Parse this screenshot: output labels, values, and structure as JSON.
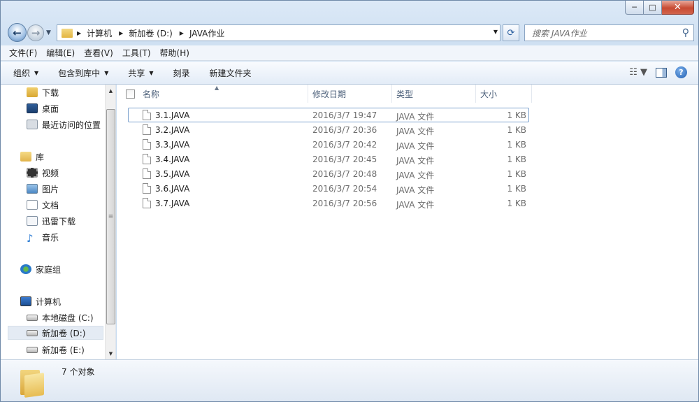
{
  "window": {
    "controls": {
      "minimize": "─",
      "maximize": "□",
      "close": "✕"
    }
  },
  "navigation": {
    "back_icon": "arrow-left",
    "forward_icon": "arrow-right",
    "breadcrumb": [
      "计算机",
      "新加卷 (D:)",
      "JAVA作业"
    ],
    "search_placeholder": "搜索 JAVA作业"
  },
  "menubar": [
    "文件(F)",
    "编辑(E)",
    "查看(V)",
    "工具(T)",
    "帮助(H)"
  ],
  "toolbar": {
    "organize": "组织",
    "include_in_library": "包含到库中",
    "share": "共享",
    "burn": "刻录",
    "new_folder": "新建文件夹"
  },
  "sidebar": {
    "favorites": [
      "下载",
      "桌面",
      "最近访问的位置"
    ],
    "libraries_header": "库",
    "libraries": [
      "视频",
      "图片",
      "文档",
      "迅雷下载",
      "音乐"
    ],
    "homegroup": "家庭组",
    "computer_header": "计算机",
    "drives": [
      "本地磁盘 (C:)",
      "新加卷 (D:)",
      "新加卷 (E:)"
    ],
    "selected": "新加卷 (D:)"
  },
  "columns": {
    "name": "名称",
    "date": "修改日期",
    "type": "类型",
    "size": "大小"
  },
  "files": [
    {
      "name": "3.1.JAVA",
      "date": "2016/3/7 19:47",
      "type": "JAVA 文件",
      "size": "1 KB"
    },
    {
      "name": "3.2.JAVA",
      "date": "2016/3/7 20:36",
      "type": "JAVA 文件",
      "size": "1 KB"
    },
    {
      "name": "3.3.JAVA",
      "date": "2016/3/7 20:42",
      "type": "JAVA 文件",
      "size": "1 KB"
    },
    {
      "name": "3.4.JAVA",
      "date": "2016/3/7 20:45",
      "type": "JAVA 文件",
      "size": "1 KB"
    },
    {
      "name": "3.5.JAVA",
      "date": "2016/3/7 20:48",
      "type": "JAVA 文件",
      "size": "1 KB"
    },
    {
      "name": "3.6.JAVA",
      "date": "2016/3/7 20:54",
      "type": "JAVA 文件",
      "size": "1 KB"
    },
    {
      "name": "3.7.JAVA",
      "date": "2016/3/7 20:56",
      "type": "JAVA 文件",
      "size": "1 KB"
    }
  ],
  "status": {
    "item_count": "7 个对象"
  }
}
